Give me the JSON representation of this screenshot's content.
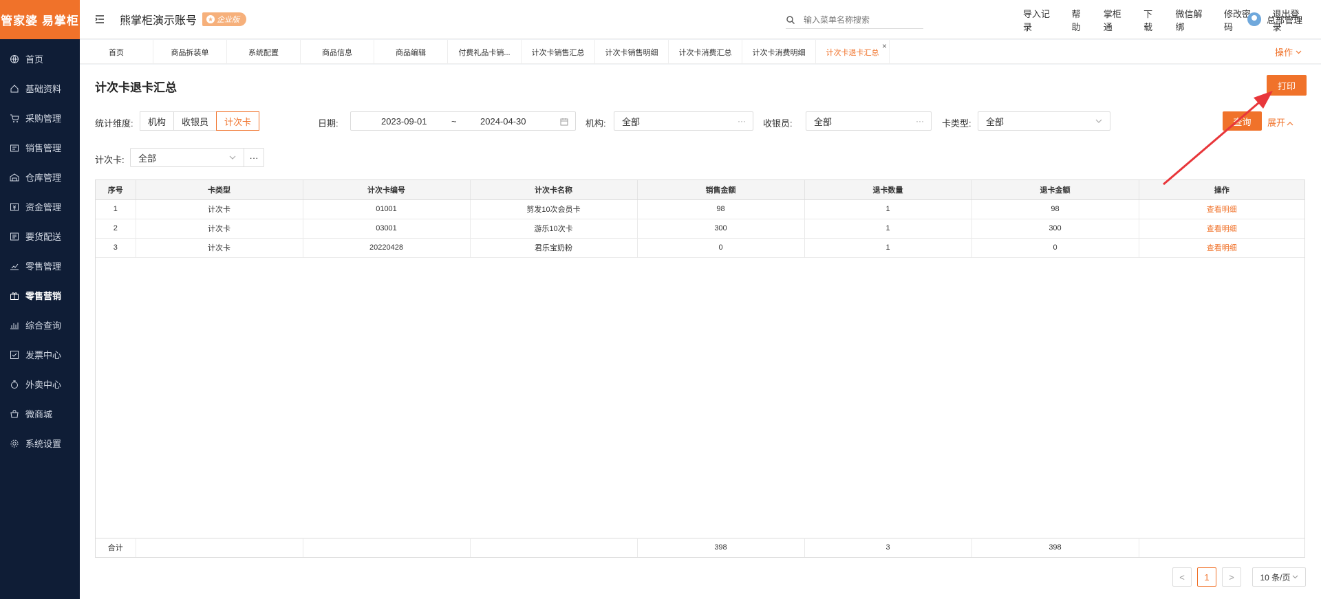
{
  "app": {
    "logo_text": "管家婆 易掌柜",
    "account_name": "熊掌柜演示账号",
    "vip_label": "企业版"
  },
  "sidebar": {
    "items": [
      {
        "label": "首页",
        "icon": "globe-icon"
      },
      {
        "label": "基础资料",
        "icon": "home-icon"
      },
      {
        "label": "采购管理",
        "icon": "cart-icon"
      },
      {
        "label": "销售管理",
        "icon": "sales-icon"
      },
      {
        "label": "仓库管理",
        "icon": "warehouse-icon"
      },
      {
        "label": "资金管理",
        "icon": "money-icon"
      },
      {
        "label": "要货配送",
        "icon": "delivery-icon"
      },
      {
        "label": "零售管理",
        "icon": "chart-icon"
      },
      {
        "label": "零售营销",
        "icon": "gift-icon"
      },
      {
        "label": "综合查询",
        "icon": "query-icon"
      },
      {
        "label": "发票中心",
        "icon": "invoice-icon"
      },
      {
        "label": "外卖中心",
        "icon": "takeout-icon"
      },
      {
        "label": "微商城",
        "icon": "shop-icon"
      },
      {
        "label": "系统设置",
        "icon": "gear-icon"
      }
    ],
    "active_index": 8
  },
  "header": {
    "search_placeholder": "输入菜单名称搜索",
    "links": [
      "导入记录",
      "帮助",
      "掌柜通",
      "下载",
      "微信解绑",
      "修改密码",
      "退出登录"
    ],
    "user_name": "总部管理"
  },
  "tabs": {
    "items": [
      "首页",
      "商品拆装单",
      "系统配置",
      "商品信息",
      "商品编辑",
      "付费礼品卡销...",
      "计次卡销售汇总",
      "计次卡销售明细",
      "计次卡消费汇总",
      "计次卡消费明细",
      "计次卡退卡汇总"
    ],
    "active_index": 10,
    "close_glyph": "×",
    "ops_label": "操作"
  },
  "page": {
    "title": "计次卡退卡汇总",
    "print_label": "打印"
  },
  "filters": {
    "dimension_label": "统计维度:",
    "dimension_options": [
      "机构",
      "收银员",
      "计次卡"
    ],
    "dimension_selected": 2,
    "date_label": "日期:",
    "date_start": "2023-09-01",
    "date_sep": "~",
    "date_end": "2024-04-30",
    "org_label": "机构:",
    "org_value": "全部",
    "cashier_label": "收银员:",
    "cashier_value": "全部",
    "card_type_label": "卡类型:",
    "card_type_value": "全部",
    "query_label": "查询",
    "expand_label": "展开",
    "card_label": "计次卡:",
    "card_value": "全部",
    "more_glyph": "···"
  },
  "table": {
    "columns": [
      "序号",
      "卡类型",
      "计次卡编号",
      "计次卡名称",
      "销售金额",
      "退卡数量",
      "退卡金额",
      "操作"
    ],
    "rows": [
      {
        "no": "1",
        "type": "计次卡",
        "code": "01001",
        "name": "剪发10次会员卡",
        "sales": "98",
        "qty": "1",
        "amount": "98",
        "action": "查看明细"
      },
      {
        "no": "2",
        "type": "计次卡",
        "code": "03001",
        "name": "游乐10次卡",
        "sales": "300",
        "qty": "1",
        "amount": "300",
        "action": "查看明细"
      },
      {
        "no": "3",
        "type": "计次卡",
        "code": "20220428",
        "name": "君乐宝奶粉",
        "sales": "0",
        "qty": "1",
        "amount": "0",
        "action": "查看明细"
      }
    ],
    "total": {
      "label": "合计",
      "sales": "398",
      "qty": "3",
      "amount": "398"
    }
  },
  "pagination": {
    "current": "1",
    "page_size": "10 条/页",
    "prev_glyph": "<",
    "next_glyph": ">"
  },
  "colors": {
    "accent": "#f0722a",
    "sidebar_bg": "#0f1d36",
    "arrow": "#e8363a"
  }
}
